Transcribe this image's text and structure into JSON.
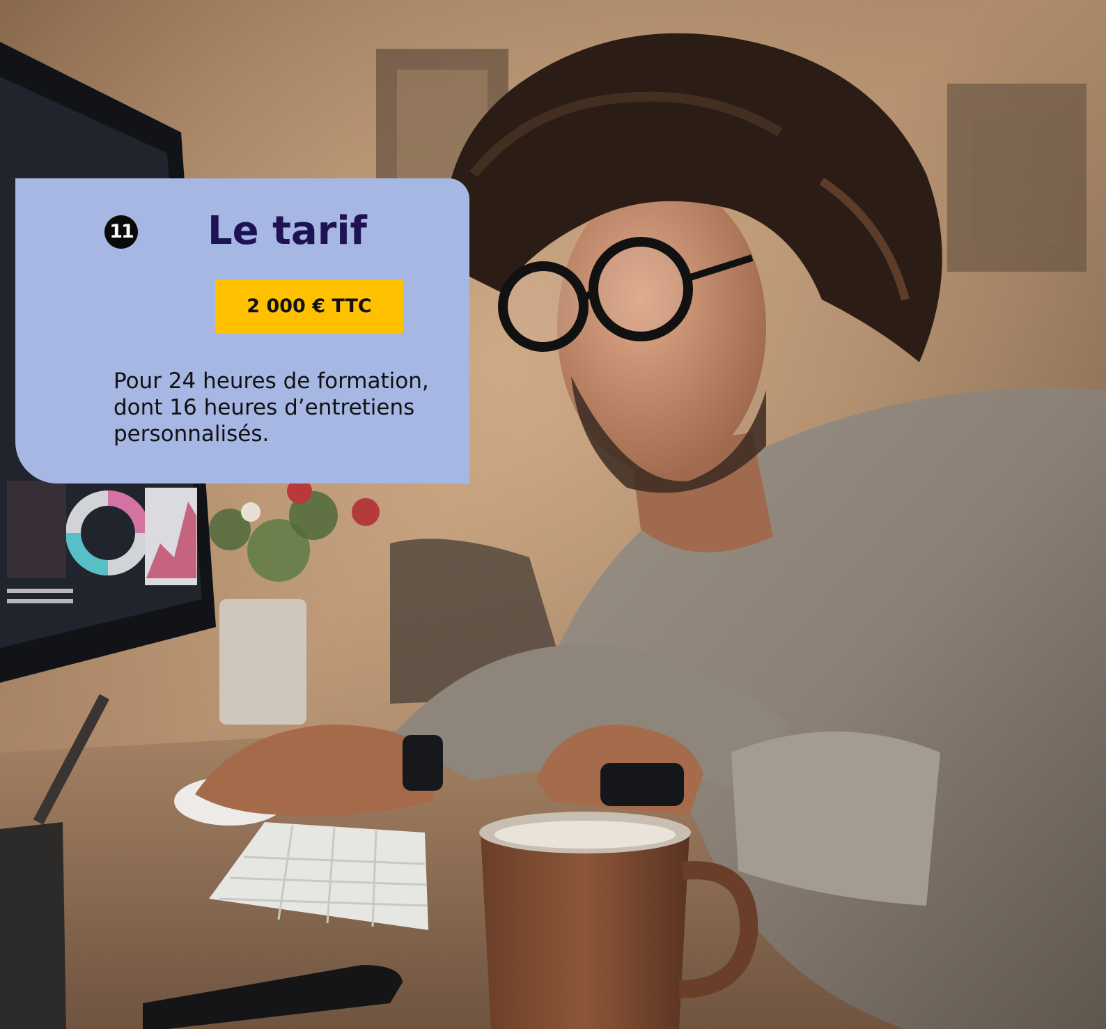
{
  "colors": {
    "card_background": "#a5b7e2",
    "title_color": "#1f1254",
    "badge_background": "#ffc000",
    "number_badge_background": "#0a0a0a"
  },
  "photo": {
    "subject": "man with curly hair and black glasses at a desk looking at a monitor, with keyboard, mouse, mug and flowers"
  },
  "card": {
    "number": "11",
    "title": "Le tarif",
    "price": "2 000 € TTC",
    "description_lines": [
      "Pour 24 heures de formation,",
      "dont 16 heures d’entretiens",
      "personnalisés."
    ]
  }
}
